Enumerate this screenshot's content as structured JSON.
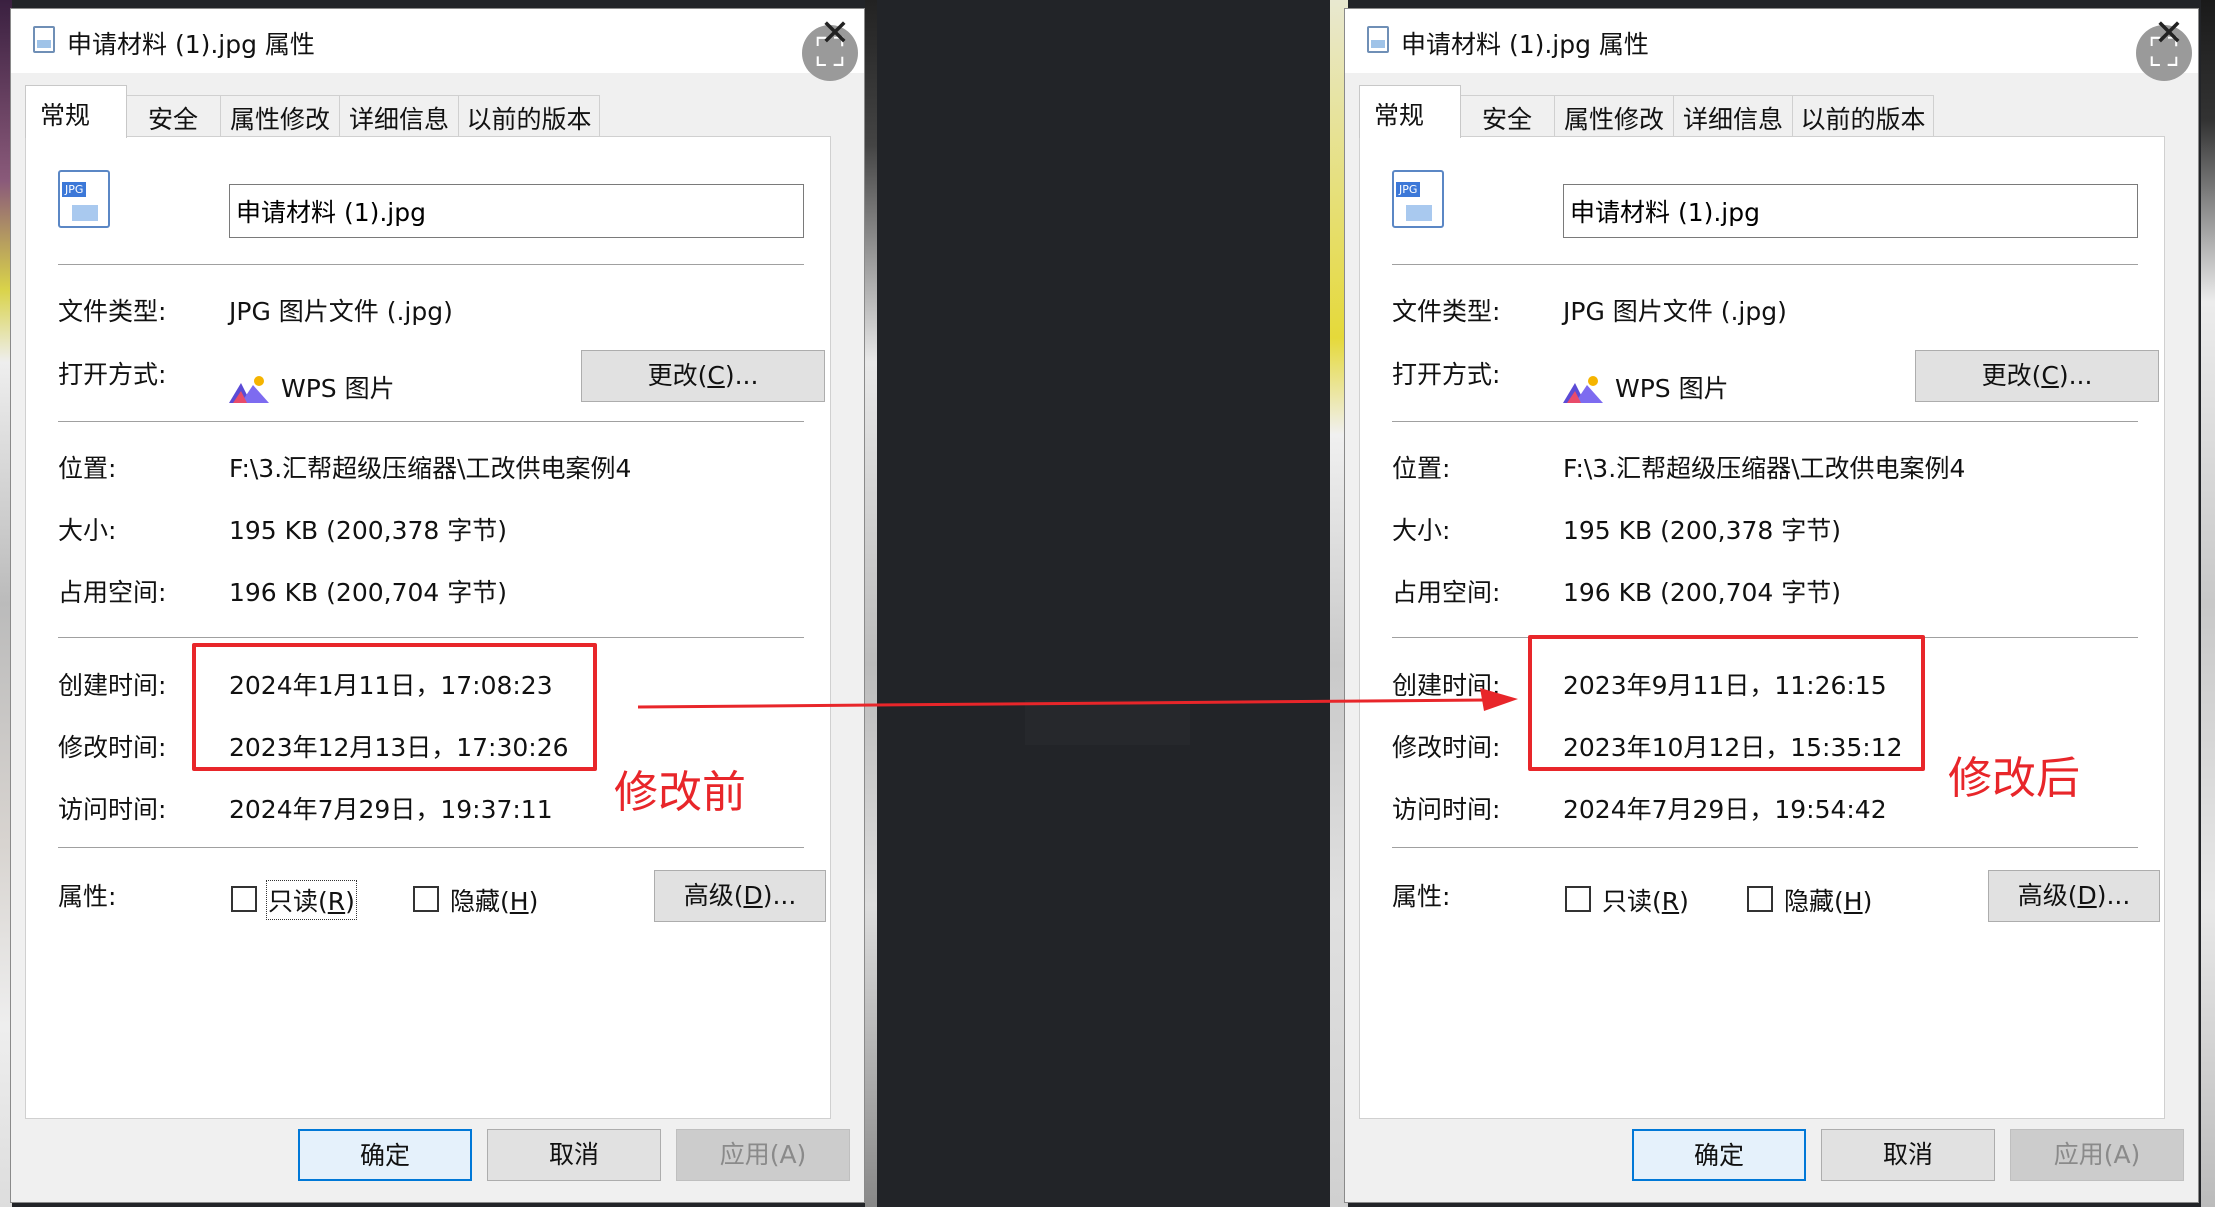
{
  "colors": {
    "accent_red": "#e8262a",
    "default_button_border": "#0078d7",
    "window_bg": "#f0f0f0"
  },
  "icons": {
    "file_type": "jpg-file-icon",
    "open_with_app": "wps-picture-icon",
    "close": "close-icon",
    "checkbox": "checkbox-icon"
  },
  "dialog_before": {
    "title": "申请材料 (1).jpg 属性",
    "close_symbol": "✕",
    "tabs": [
      {
        "label": "常规",
        "active": true
      },
      {
        "label": "安全"
      },
      {
        "label": "属性修改"
      },
      {
        "label": "详细信息"
      },
      {
        "label": "以前的版本"
      }
    ],
    "file_name": "申请材料 (1).jpg",
    "icon_badge": "JPG",
    "file_type_label": "文件类型:",
    "file_type_value": "JPG 图片文件 (.jpg)",
    "open_with_label": "打开方式:",
    "open_with_value": "WPS 图片",
    "change_button_text": "更改(",
    "change_button_key": "C",
    "change_button_suffix": ")...",
    "location_label": "位置:",
    "location_value": "F:\\3.汇帮超级压缩器\\工改供电案例4",
    "size_label": "大小:",
    "size_value": "195 KB (200,378 字节)",
    "disk_size_label": "占用空间:",
    "disk_size_value": "196 KB (200,704 字节)",
    "created_label": "创建时间:",
    "created_value": "2024年1月11日，17:08:23",
    "modified_label": "修改时间:",
    "modified_value": "2023年12月13日，17:30:26",
    "accessed_label": "访问时间:",
    "accessed_value": "2024年7月29日，19:37:11",
    "attributes_label": "属性:",
    "readonly_text": "只读(",
    "readonly_key": "R",
    "readonly_suffix": ")",
    "hidden_text": "隐藏(",
    "hidden_key": "H",
    "hidden_suffix": ")",
    "advanced_text": "高级(",
    "advanced_key": "D",
    "advanced_suffix": ")...",
    "ok_label": "确定",
    "cancel_label": "取消",
    "apply_label": "应用(A)"
  },
  "dialog_after": {
    "title": "申请材料 (1).jpg 属性",
    "close_symbol": "✕",
    "tabs": [
      {
        "label": "常规",
        "active": true
      },
      {
        "label": "安全"
      },
      {
        "label": "属性修改"
      },
      {
        "label": "详细信息"
      },
      {
        "label": "以前的版本"
      }
    ],
    "file_name": "申请材料 (1).jpg",
    "icon_badge": "JPG",
    "file_type_label": "文件类型:",
    "file_type_value": "JPG 图片文件 (.jpg)",
    "open_with_label": "打开方式:",
    "open_with_value": "WPS 图片",
    "change_button_text": "更改(",
    "change_button_key": "C",
    "change_button_suffix": ")...",
    "location_label": "位置:",
    "location_value": "F:\\3.汇帮超级压缩器\\工改供电案例4",
    "size_label": "大小:",
    "size_value": "195 KB (200,378 字节)",
    "disk_size_label": "占用空间:",
    "disk_size_value": "196 KB (200,704 字节)",
    "created_label": "创建时间:",
    "created_value": "2023年9月11日，11:26:15",
    "modified_label": "修改时间:",
    "modified_value": "2023年10月12日，15:35:12",
    "accessed_label": "访问时间:",
    "accessed_value": "2024年7月29日，19:54:42",
    "attributes_label": "属性:",
    "readonly_text": "只读(",
    "readonly_key": "R",
    "readonly_suffix": ")",
    "hidden_text": "隐藏(",
    "hidden_key": "H",
    "hidden_suffix": ")",
    "advanced_text": "高级(",
    "advanced_key": "D",
    "advanced_suffix": ")...",
    "ok_label": "确定",
    "cancel_label": "取消",
    "apply_label": "应用(A)"
  },
  "annotations": {
    "before_note": "修改前",
    "after_note": "修改后"
  }
}
